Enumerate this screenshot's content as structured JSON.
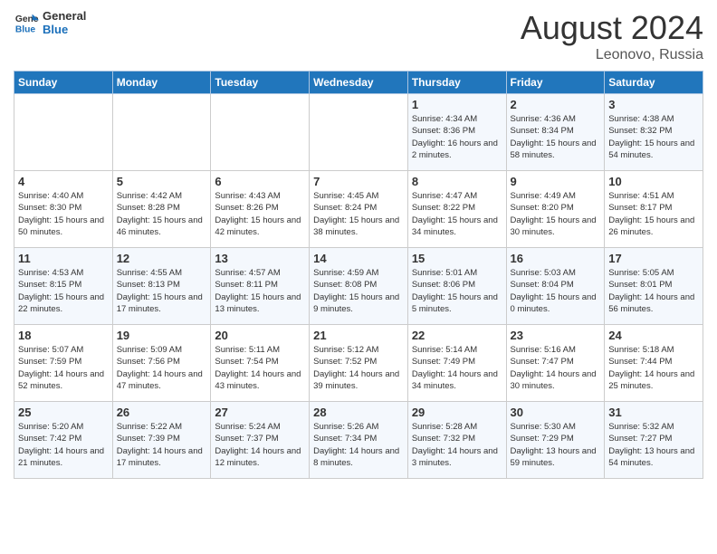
{
  "header": {
    "logo": {
      "general": "General",
      "blue": "Blue"
    },
    "title": "August 2024",
    "location": "Leonovo, Russia"
  },
  "weekdays": [
    "Sunday",
    "Monday",
    "Tuesday",
    "Wednesday",
    "Thursday",
    "Friday",
    "Saturday"
  ],
  "weeks": [
    [
      {
        "day": "",
        "info": ""
      },
      {
        "day": "",
        "info": ""
      },
      {
        "day": "",
        "info": ""
      },
      {
        "day": "",
        "info": ""
      },
      {
        "day": "1",
        "info": "Sunrise: 4:34 AM\nSunset: 8:36 PM\nDaylight: 16 hours\nand 2 minutes."
      },
      {
        "day": "2",
        "info": "Sunrise: 4:36 AM\nSunset: 8:34 PM\nDaylight: 15 hours\nand 58 minutes."
      },
      {
        "day": "3",
        "info": "Sunrise: 4:38 AM\nSunset: 8:32 PM\nDaylight: 15 hours\nand 54 minutes."
      }
    ],
    [
      {
        "day": "4",
        "info": "Sunrise: 4:40 AM\nSunset: 8:30 PM\nDaylight: 15 hours\nand 50 minutes."
      },
      {
        "day": "5",
        "info": "Sunrise: 4:42 AM\nSunset: 8:28 PM\nDaylight: 15 hours\nand 46 minutes."
      },
      {
        "day": "6",
        "info": "Sunrise: 4:43 AM\nSunset: 8:26 PM\nDaylight: 15 hours\nand 42 minutes."
      },
      {
        "day": "7",
        "info": "Sunrise: 4:45 AM\nSunset: 8:24 PM\nDaylight: 15 hours\nand 38 minutes."
      },
      {
        "day": "8",
        "info": "Sunrise: 4:47 AM\nSunset: 8:22 PM\nDaylight: 15 hours\nand 34 minutes."
      },
      {
        "day": "9",
        "info": "Sunrise: 4:49 AM\nSunset: 8:20 PM\nDaylight: 15 hours\nand 30 minutes."
      },
      {
        "day": "10",
        "info": "Sunrise: 4:51 AM\nSunset: 8:17 PM\nDaylight: 15 hours\nand 26 minutes."
      }
    ],
    [
      {
        "day": "11",
        "info": "Sunrise: 4:53 AM\nSunset: 8:15 PM\nDaylight: 15 hours\nand 22 minutes."
      },
      {
        "day": "12",
        "info": "Sunrise: 4:55 AM\nSunset: 8:13 PM\nDaylight: 15 hours\nand 17 minutes."
      },
      {
        "day": "13",
        "info": "Sunrise: 4:57 AM\nSunset: 8:11 PM\nDaylight: 15 hours\nand 13 minutes."
      },
      {
        "day": "14",
        "info": "Sunrise: 4:59 AM\nSunset: 8:08 PM\nDaylight: 15 hours\nand 9 minutes."
      },
      {
        "day": "15",
        "info": "Sunrise: 5:01 AM\nSunset: 8:06 PM\nDaylight: 15 hours\nand 5 minutes."
      },
      {
        "day": "16",
        "info": "Sunrise: 5:03 AM\nSunset: 8:04 PM\nDaylight: 15 hours\nand 0 minutes."
      },
      {
        "day": "17",
        "info": "Sunrise: 5:05 AM\nSunset: 8:01 PM\nDaylight: 14 hours\nand 56 minutes."
      }
    ],
    [
      {
        "day": "18",
        "info": "Sunrise: 5:07 AM\nSunset: 7:59 PM\nDaylight: 14 hours\nand 52 minutes."
      },
      {
        "day": "19",
        "info": "Sunrise: 5:09 AM\nSunset: 7:56 PM\nDaylight: 14 hours\nand 47 minutes."
      },
      {
        "day": "20",
        "info": "Sunrise: 5:11 AM\nSunset: 7:54 PM\nDaylight: 14 hours\nand 43 minutes."
      },
      {
        "day": "21",
        "info": "Sunrise: 5:12 AM\nSunset: 7:52 PM\nDaylight: 14 hours\nand 39 minutes."
      },
      {
        "day": "22",
        "info": "Sunrise: 5:14 AM\nSunset: 7:49 PM\nDaylight: 14 hours\nand 34 minutes."
      },
      {
        "day": "23",
        "info": "Sunrise: 5:16 AM\nSunset: 7:47 PM\nDaylight: 14 hours\nand 30 minutes."
      },
      {
        "day": "24",
        "info": "Sunrise: 5:18 AM\nSunset: 7:44 PM\nDaylight: 14 hours\nand 25 minutes."
      }
    ],
    [
      {
        "day": "25",
        "info": "Sunrise: 5:20 AM\nSunset: 7:42 PM\nDaylight: 14 hours\nand 21 minutes."
      },
      {
        "day": "26",
        "info": "Sunrise: 5:22 AM\nSunset: 7:39 PM\nDaylight: 14 hours\nand 17 minutes."
      },
      {
        "day": "27",
        "info": "Sunrise: 5:24 AM\nSunset: 7:37 PM\nDaylight: 14 hours\nand 12 minutes."
      },
      {
        "day": "28",
        "info": "Sunrise: 5:26 AM\nSunset: 7:34 PM\nDaylight: 14 hours\nand 8 minutes."
      },
      {
        "day": "29",
        "info": "Sunrise: 5:28 AM\nSunset: 7:32 PM\nDaylight: 14 hours\nand 3 minutes."
      },
      {
        "day": "30",
        "info": "Sunrise: 5:30 AM\nSunset: 7:29 PM\nDaylight: 13 hours\nand 59 minutes."
      },
      {
        "day": "31",
        "info": "Sunrise: 5:32 AM\nSunset: 7:27 PM\nDaylight: 13 hours\nand 54 minutes."
      }
    ]
  ]
}
